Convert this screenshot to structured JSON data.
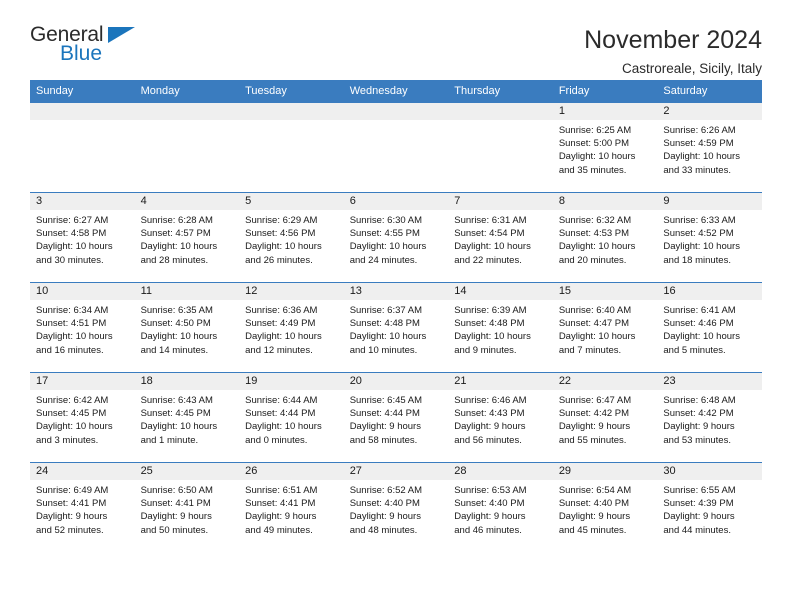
{
  "brand": {
    "name_part1": "General",
    "name_part2": "Blue",
    "accent_color": "#1b75bc"
  },
  "header": {
    "title": "November 2024",
    "subtitle": "Castroreale, Sicily, Italy"
  },
  "calendar": {
    "header_bg": "#3a7cbf",
    "daynum_bg": "#efefef",
    "weekday_headers": [
      "Sunday",
      "Monday",
      "Tuesday",
      "Wednesday",
      "Thursday",
      "Friday",
      "Saturday"
    ],
    "labels": {
      "sunrise": "Sunrise:",
      "sunset": "Sunset:",
      "daylight": "Daylight:"
    },
    "weeks": [
      [
        {
          "empty": true
        },
        {
          "empty": true
        },
        {
          "empty": true
        },
        {
          "empty": true
        },
        {
          "empty": true
        },
        {
          "day": "1",
          "sunrise": "Sunrise: 6:25 AM",
          "sunset": "Sunset: 5:00 PM",
          "daylight1": "Daylight: 10 hours",
          "daylight2": "and 35 minutes."
        },
        {
          "day": "2",
          "sunrise": "Sunrise: 6:26 AM",
          "sunset": "Sunset: 4:59 PM",
          "daylight1": "Daylight: 10 hours",
          "daylight2": "and 33 minutes."
        }
      ],
      [
        {
          "day": "3",
          "sunrise": "Sunrise: 6:27 AM",
          "sunset": "Sunset: 4:58 PM",
          "daylight1": "Daylight: 10 hours",
          "daylight2": "and 30 minutes."
        },
        {
          "day": "4",
          "sunrise": "Sunrise: 6:28 AM",
          "sunset": "Sunset: 4:57 PM",
          "daylight1": "Daylight: 10 hours",
          "daylight2": "and 28 minutes."
        },
        {
          "day": "5",
          "sunrise": "Sunrise: 6:29 AM",
          "sunset": "Sunset: 4:56 PM",
          "daylight1": "Daylight: 10 hours",
          "daylight2": "and 26 minutes."
        },
        {
          "day": "6",
          "sunrise": "Sunrise: 6:30 AM",
          "sunset": "Sunset: 4:55 PM",
          "daylight1": "Daylight: 10 hours",
          "daylight2": "and 24 minutes."
        },
        {
          "day": "7",
          "sunrise": "Sunrise: 6:31 AM",
          "sunset": "Sunset: 4:54 PM",
          "daylight1": "Daylight: 10 hours",
          "daylight2": "and 22 minutes."
        },
        {
          "day": "8",
          "sunrise": "Sunrise: 6:32 AM",
          "sunset": "Sunset: 4:53 PM",
          "daylight1": "Daylight: 10 hours",
          "daylight2": "and 20 minutes."
        },
        {
          "day": "9",
          "sunrise": "Sunrise: 6:33 AM",
          "sunset": "Sunset: 4:52 PM",
          "daylight1": "Daylight: 10 hours",
          "daylight2": "and 18 minutes."
        }
      ],
      [
        {
          "day": "10",
          "sunrise": "Sunrise: 6:34 AM",
          "sunset": "Sunset: 4:51 PM",
          "daylight1": "Daylight: 10 hours",
          "daylight2": "and 16 minutes."
        },
        {
          "day": "11",
          "sunrise": "Sunrise: 6:35 AM",
          "sunset": "Sunset: 4:50 PM",
          "daylight1": "Daylight: 10 hours",
          "daylight2": "and 14 minutes."
        },
        {
          "day": "12",
          "sunrise": "Sunrise: 6:36 AM",
          "sunset": "Sunset: 4:49 PM",
          "daylight1": "Daylight: 10 hours",
          "daylight2": "and 12 minutes."
        },
        {
          "day": "13",
          "sunrise": "Sunrise: 6:37 AM",
          "sunset": "Sunset: 4:48 PM",
          "daylight1": "Daylight: 10 hours",
          "daylight2": "and 10 minutes."
        },
        {
          "day": "14",
          "sunrise": "Sunrise: 6:39 AM",
          "sunset": "Sunset: 4:48 PM",
          "daylight1": "Daylight: 10 hours",
          "daylight2": "and 9 minutes."
        },
        {
          "day": "15",
          "sunrise": "Sunrise: 6:40 AM",
          "sunset": "Sunset: 4:47 PM",
          "daylight1": "Daylight: 10 hours",
          "daylight2": "and 7 minutes."
        },
        {
          "day": "16",
          "sunrise": "Sunrise: 6:41 AM",
          "sunset": "Sunset: 4:46 PM",
          "daylight1": "Daylight: 10 hours",
          "daylight2": "and 5 minutes."
        }
      ],
      [
        {
          "day": "17",
          "sunrise": "Sunrise: 6:42 AM",
          "sunset": "Sunset: 4:45 PM",
          "daylight1": "Daylight: 10 hours",
          "daylight2": "and 3 minutes."
        },
        {
          "day": "18",
          "sunrise": "Sunrise: 6:43 AM",
          "sunset": "Sunset: 4:45 PM",
          "daylight1": "Daylight: 10 hours",
          "daylight2": "and 1 minute."
        },
        {
          "day": "19",
          "sunrise": "Sunrise: 6:44 AM",
          "sunset": "Sunset: 4:44 PM",
          "daylight1": "Daylight: 10 hours",
          "daylight2": "and 0 minutes."
        },
        {
          "day": "20",
          "sunrise": "Sunrise: 6:45 AM",
          "sunset": "Sunset: 4:44 PM",
          "daylight1": "Daylight: 9 hours",
          "daylight2": "and 58 minutes."
        },
        {
          "day": "21",
          "sunrise": "Sunrise: 6:46 AM",
          "sunset": "Sunset: 4:43 PM",
          "daylight1": "Daylight: 9 hours",
          "daylight2": "and 56 minutes."
        },
        {
          "day": "22",
          "sunrise": "Sunrise: 6:47 AM",
          "sunset": "Sunset: 4:42 PM",
          "daylight1": "Daylight: 9 hours",
          "daylight2": "and 55 minutes."
        },
        {
          "day": "23",
          "sunrise": "Sunrise: 6:48 AM",
          "sunset": "Sunset: 4:42 PM",
          "daylight1": "Daylight: 9 hours",
          "daylight2": "and 53 minutes."
        }
      ],
      [
        {
          "day": "24",
          "sunrise": "Sunrise: 6:49 AM",
          "sunset": "Sunset: 4:41 PM",
          "daylight1": "Daylight: 9 hours",
          "daylight2": "and 52 minutes."
        },
        {
          "day": "25",
          "sunrise": "Sunrise: 6:50 AM",
          "sunset": "Sunset: 4:41 PM",
          "daylight1": "Daylight: 9 hours",
          "daylight2": "and 50 minutes."
        },
        {
          "day": "26",
          "sunrise": "Sunrise: 6:51 AM",
          "sunset": "Sunset: 4:41 PM",
          "daylight1": "Daylight: 9 hours",
          "daylight2": "and 49 minutes."
        },
        {
          "day": "27",
          "sunrise": "Sunrise: 6:52 AM",
          "sunset": "Sunset: 4:40 PM",
          "daylight1": "Daylight: 9 hours",
          "daylight2": "and 48 minutes."
        },
        {
          "day": "28",
          "sunrise": "Sunrise: 6:53 AM",
          "sunset": "Sunset: 4:40 PM",
          "daylight1": "Daylight: 9 hours",
          "daylight2": "and 46 minutes."
        },
        {
          "day": "29",
          "sunrise": "Sunrise: 6:54 AM",
          "sunset": "Sunset: 4:40 PM",
          "daylight1": "Daylight: 9 hours",
          "daylight2": "and 45 minutes."
        },
        {
          "day": "30",
          "sunrise": "Sunrise: 6:55 AM",
          "sunset": "Sunset: 4:39 PM",
          "daylight1": "Daylight: 9 hours",
          "daylight2": "and 44 minutes."
        }
      ]
    ]
  }
}
